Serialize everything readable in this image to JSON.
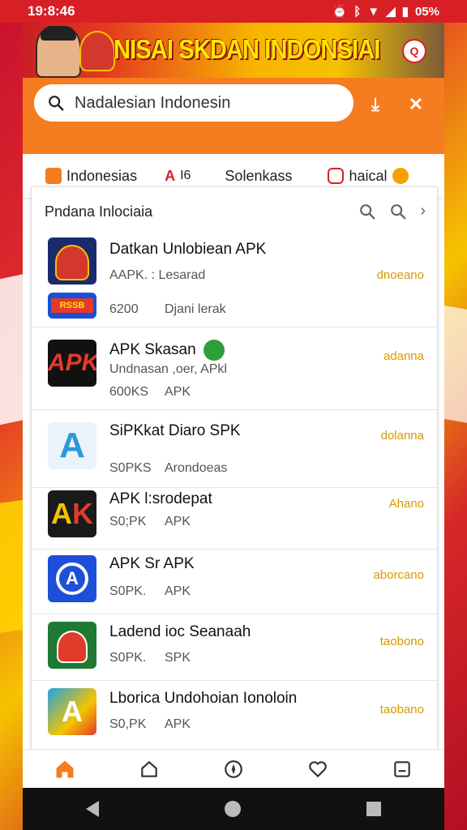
{
  "status": {
    "time": "19:8:46",
    "battery": "05%"
  },
  "banner": {
    "title": "NISAI SKDAN INDONSIAI"
  },
  "search": {
    "value": "Nadalesian Indonesin"
  },
  "tabs": [
    {
      "label": "Indonesias"
    },
    {
      "label": "A"
    },
    {
      "label": "Solenkass"
    },
    {
      "label": "haical"
    }
  ],
  "list": {
    "header": "Pndana Inlociaia",
    "apps": [
      {
        "title": "Datkan Unlobiean APK",
        "sub": "AAPK. :  Lesarad",
        "size": "6200",
        "extra": "Djani lerak",
        "action": "dnoeano"
      },
      {
        "title": "APK Skasan",
        "sub": "Undnasan ,oer, APkl",
        "size": "600KS",
        "extra": "APK",
        "action": "adanna"
      },
      {
        "title": "SiPKkat Diaro SPK",
        "sub": "",
        "size": "S0PKS",
        "extra": "Arondoeas",
        "action": "dolanna"
      },
      {
        "title": "APK l:srodepat",
        "sub": "",
        "size": "S0;PK",
        "extra": "APK",
        "action": "Ahano"
      },
      {
        "title": "APK Sr APK",
        "sub": "",
        "size": "S0PK.",
        "extra": "APK",
        "action": "aborcano"
      },
      {
        "title": "Ladend ioc Seanaah",
        "sub": "",
        "size": "S0PK.",
        "extra": "SPK",
        "action": "taobono"
      },
      {
        "title": "Lborica Undohoian Ionoloin",
        "sub": "",
        "size": "S0,PK",
        "extra": "APK",
        "action": "taobano"
      }
    ]
  },
  "colors": {
    "accent": "#f57c1f",
    "action": "#d79a00",
    "status": "#d91f26"
  }
}
